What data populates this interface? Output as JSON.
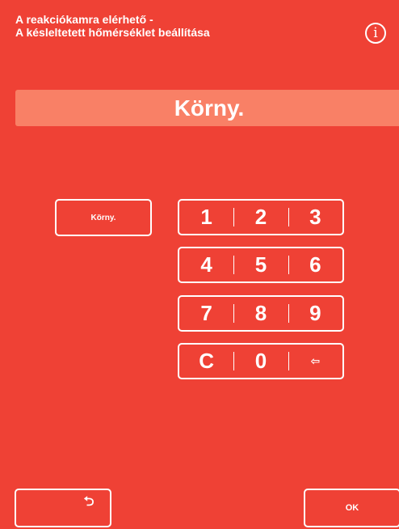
{
  "header": {
    "title_line1": "A reakciókamra elérhető -",
    "title_line2": "A késleltetett hőmérséklet beállítása",
    "info_icon": "i"
  },
  "display": {
    "value": "Körny."
  },
  "preset": {
    "label": "Körny."
  },
  "keypad": {
    "rows": [
      [
        "1",
        "2",
        "3"
      ],
      [
        "4",
        "5",
        "6"
      ],
      [
        "7",
        "8",
        "9"
      ],
      [
        "C",
        "0",
        "⇦"
      ]
    ]
  },
  "footer": {
    "back_icon": "⮌",
    "ok_label": "OK"
  },
  "colors": {
    "background": "#ef4135",
    "display_bar": "#f98066",
    "foreground": "#ffffff"
  },
  "icons": {
    "info": "info-icon",
    "backspace": "backspace-arrow-icon",
    "back": "return-arrow-icon"
  }
}
